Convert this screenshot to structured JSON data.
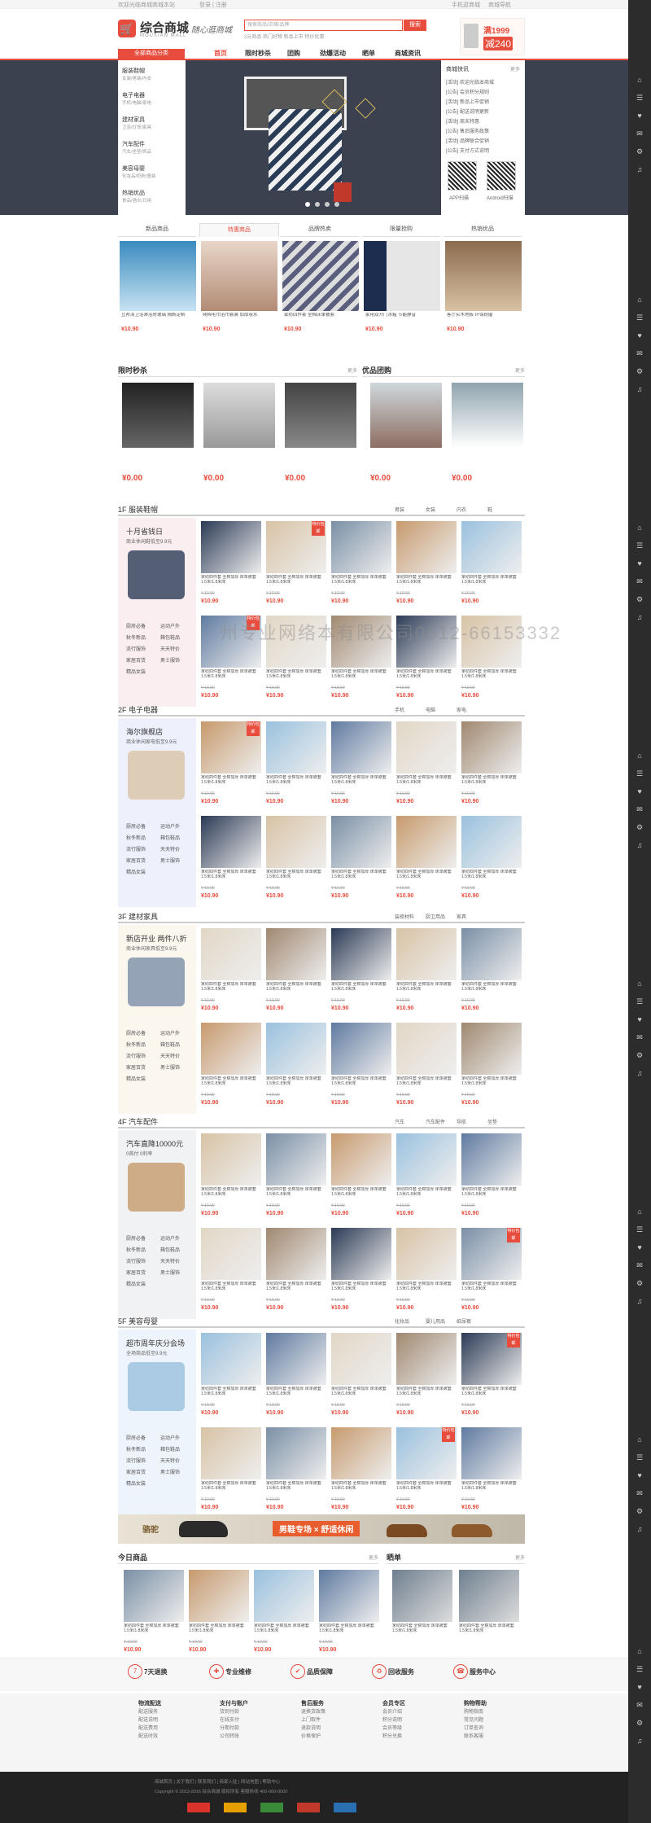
{
  "topbar": {
    "left": "欢迎光临商城商城本站",
    "mid": "登录 | 注册",
    "right1": "手机逛商城",
    "right2": "商城导航"
  },
  "header": {
    "logo_title": "综合商城",
    "logo_sub": "MOUXIAN MALL",
    "slogan": "随心逛商城",
    "search_placeholder": "搜索商品/店铺/品牌",
    "search_button": "搜索",
    "hot_words": "2元商品 热门好物 新品上市 特价优惠",
    "promo_top": "满1999",
    "promo_bottom": "减240"
  },
  "nav": {
    "category_header": "全部商品分类",
    "items": [
      "首页",
      "限时秒杀",
      "团购",
      "劲爆活动",
      "晒单",
      "商城资讯"
    ]
  },
  "categories": [
    {
      "name": "服装鞋帽",
      "sub": "女装/男装/内衣"
    },
    {
      "name": "电子电器",
      "sub": "手机/电脑/家电"
    },
    {
      "name": "建材家具",
      "sub": "卫浴/灯饰/家具"
    },
    {
      "name": "汽车配件",
      "sub": "汽车/坐垫/饰品"
    },
    {
      "name": "美容母婴",
      "sub": "化妆品/奶粉/童装"
    },
    {
      "name": "热销优品",
      "sub": "食品/酒水/日用"
    }
  ],
  "news": {
    "title": "商城快讯",
    "more": "更多",
    "items": [
      "[活动] 欢迎光临本商城",
      "[公告] 会员积分规则",
      "[活动] 新品上市促销",
      "[公告] 配送说明更新",
      "[活动] 周末特惠",
      "[公告] 售后服务政策",
      "[活动] 品牌联合促销",
      "[公告] 支付方式说明"
    ],
    "qr1": "APP扫描",
    "qr2": "Android扫描"
  },
  "tabs": [
    "新品商品",
    "特惠商品",
    "品牌热卖",
    "限量抢购",
    "热销优品"
  ],
  "featured": [
    {
      "name": "立邦漆卫浴淋浴房玻璃 隔断定制",
      "price": "¥10.90"
    },
    {
      "name": "纯棉毛巾浴巾套装 加厚吸水",
      "price": "¥10.90"
    },
    {
      "name": "家纺四件套 全棉床单被套",
      "price": "¥10.90"
    },
    {
      "name": "家用双开门冰箱 节能静音",
      "price": "¥10.90"
    },
    {
      "name": "客厅实木地板 环保耐磨",
      "price": "¥10.90"
    }
  ],
  "flash": {
    "title": "限时秒杀",
    "more": "更多",
    "items": [
      {
        "price": "¥0.00"
      },
      {
        "price": "¥0.00"
      },
      {
        "price": "¥0.00"
      }
    ]
  },
  "group": {
    "title": "优品团购",
    "more": "更多",
    "items": [
      {
        "price": "¥0.00"
      },
      {
        "price": "¥0.00"
      }
    ]
  },
  "floors": [
    {
      "label": "1F 服装鞋帽",
      "subs": [
        "男装",
        "女装",
        "内衣",
        "鞋"
      ],
      "box_title": "十月省钱日",
      "box_sub": "商业休闲鞋低至9.9元"
    },
    {
      "label": "2F 电子电器",
      "subs": [
        "手机",
        "电脑",
        "家电"
      ],
      "box_title": "海尔旗舰店",
      "box_sub": "商业休闲家电低至9.9元"
    },
    {
      "label": "3F 建材家具",
      "subs": [
        "装修材料",
        "厨卫用品",
        "家具"
      ],
      "box_title": "新店开业 两件八折",
      "box_sub": "商业休闲家具低至9.9元"
    },
    {
      "label": "4F 汽车配件",
      "subs": [
        "汽车",
        "汽车配件",
        "导航",
        "坐垫"
      ],
      "box_title": "汽车直降10000元",
      "box_sub": "0首付 0利率"
    },
    {
      "label": "5F 美容母婴",
      "subs": [
        "化妆品",
        "婴儿用品",
        "纸尿裤"
      ],
      "box_title": "超市周年庆分会场",
      "box_sub": "全场商品低至9.9元"
    }
  ],
  "floor_links": [
    "厨房必备",
    "运动户外",
    "秋冬新品",
    "箱包鞋品",
    "流行服饰",
    "天天特价",
    "家居百货",
    "男士服饰",
    "精品女装"
  ],
  "product": {
    "name": "家纺四件套 全棉加厚 床单被套 1.5米/1.8米床",
    "old": "¥ 10.90",
    "new": "¥10.90",
    "badge": "特价包邮"
  },
  "camel_banner": {
    "brand": "骆驼",
    "text": "男鞋专场 × 舒适休闲"
  },
  "recommend": {
    "title": "今日商品",
    "more": "更多"
  },
  "showcase": {
    "title": "晒单",
    "more": "更多"
  },
  "services": [
    "7天退换",
    "专业维修",
    "品质保障",
    "回收服务",
    "服务中心"
  ],
  "footer": {
    "cols": [
      {
        "title": "物流配送",
        "links": [
          "配送服务",
          "配送说明",
          "配送费用",
          "配送时效"
        ]
      },
      {
        "title": "支付与账户",
        "links": [
          "货到付款",
          "在线支付",
          "分期付款",
          "公司转账"
        ]
      },
      {
        "title": "售后服务",
        "links": [
          "退换货政策",
          "上门取件",
          "退款说明",
          "价格保护"
        ]
      },
      {
        "title": "会员专区",
        "links": [
          "会员介绍",
          "积分说明",
          "会员等级",
          "积分兑换"
        ]
      },
      {
        "title": "购物帮助",
        "links": [
          "购物指南",
          "常见问题",
          "订单查询",
          "联系客服"
        ]
      }
    ],
    "copy1": "商城首页 | 关于我们 | 联系我们 | 商家入驻 | 网站地图 | 帮助中心",
    "copy2": "Copyright © 2013-2016 综合商城 版权所有 客服热线 400-000-0000"
  },
  "watermark": "州专业网络本有限公司0512-66153332"
}
